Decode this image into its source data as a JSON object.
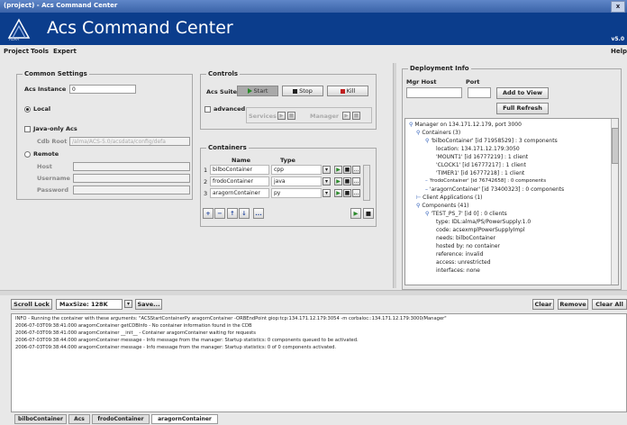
{
  "window": {
    "title": "(project) - Acs Command Center",
    "close_label": "x"
  },
  "banner": {
    "title": "Acs Command Center",
    "logo_text": "ALMA",
    "version": "v5.0"
  },
  "menu": {
    "project": "Project",
    "tools": "Tools",
    "expert": "Expert",
    "help": "Help"
  },
  "common_settings": {
    "legend": "Common Settings",
    "instance_label": "Acs Instance",
    "instance_value": "0",
    "local_label": "Local",
    "local_selected": true,
    "java_only_label": "Java-only Acs",
    "java_only_checked": false,
    "cdb_root_label": "Cdb Root",
    "cdb_root_value": "/alma/ACS-5.0/acsdata/config/defa",
    "remote_label": "Remote",
    "remote_selected": false,
    "host_label": "Host",
    "username_label": "Username",
    "password_label": "Password"
  },
  "controls": {
    "legend": "Controls",
    "acs_suite_label": "Acs Suite",
    "start": "Start",
    "stop": "Stop",
    "kill": "Kill",
    "advanced_label": "advanced",
    "services_label": "Services",
    "manager_label": "Manager"
  },
  "containers": {
    "legend": "Containers",
    "col_name": "Name",
    "col_type": "Type",
    "rows": [
      {
        "index": "1",
        "name": "bilboContainer",
        "type": "cpp"
      },
      {
        "index": "2",
        "name": "frodoContainer",
        "type": "java"
      },
      {
        "index": "3",
        "name": "aragornContainer",
        "type": "py"
      }
    ],
    "toolbar": {
      "add": "+",
      "remove": "−",
      "up": "↑",
      "down": "↓",
      "more": "..."
    }
  },
  "deployment": {
    "legend": "Deployment Info",
    "mgr_host_label": "Mgr Host",
    "port_label": "Port",
    "mgr_host_value": "",
    "port_value": "",
    "add_to_view": "Add to View",
    "full_refresh": "Full Refresh",
    "tree": [
      "Manager on 134.171.12.179, port 3000",
      "Containers (3)",
      "'bilboContainer' [id 71958529] : 3 components",
      "location: 134.171.12.179:3050",
      "'MOUNT1' [id 16777219] : 1 client",
      "'CLOCK1' [id 16777217] : 1 client",
      "'TIMER1' [id 16777218] : 1 client",
      "'frodoContainer' [id 76742658] : 0 components",
      "'aragornContainer' [id 73400323] : 0 components",
      "Client Applications (1)",
      "Components (41)",
      "'TEST_PS_7' [id 0] : 0 clients",
      "type: IDL:alma/PS/PowerSupply:1.0",
      "code: acsexmplPowerSupplyImpl",
      "needs: bilboContainer",
      "hosted by: no container",
      "reference: invalid",
      "access: unrestricted",
      "interfaces: none"
    ]
  },
  "log": {
    "scroll_lock": "Scroll Lock",
    "max_size": "MaxSize: 128K",
    "save": "Save...",
    "clear": "Clear",
    "remove": "Remove",
    "clear_all": "Clear All",
    "lines": [
      "INFO - Running the container with these arguments: \"ACSStartContainerPy aragornContainer -ORBEndPoint giop:tcp:134.171.12.179:3054 -m corbaloc::134.171.12.179:3000/Manager\"",
      "2006-07-03T09:38:41.000 aragornContainer getCDBInfo - No container information found in the CDB",
      "2006-07-03T09:38:41.000 aragornContainer __init__ - Container aragornContainer waiting for requests",
      "2006-07-03T09:38:44.000 aragornContainer message - Info message from the manager: Startup statistics: 0 components queued to be activated.",
      "2006-07-03T09:38:44.000 aragornContainer message - Info message from the manager: Startup statistics: 0 of 0 components activated."
    ],
    "tabs": [
      "bilboContainer",
      "Acs",
      "frodoContainer",
      "aragornContainer"
    ],
    "selected_tab": "aragornContainer"
  }
}
